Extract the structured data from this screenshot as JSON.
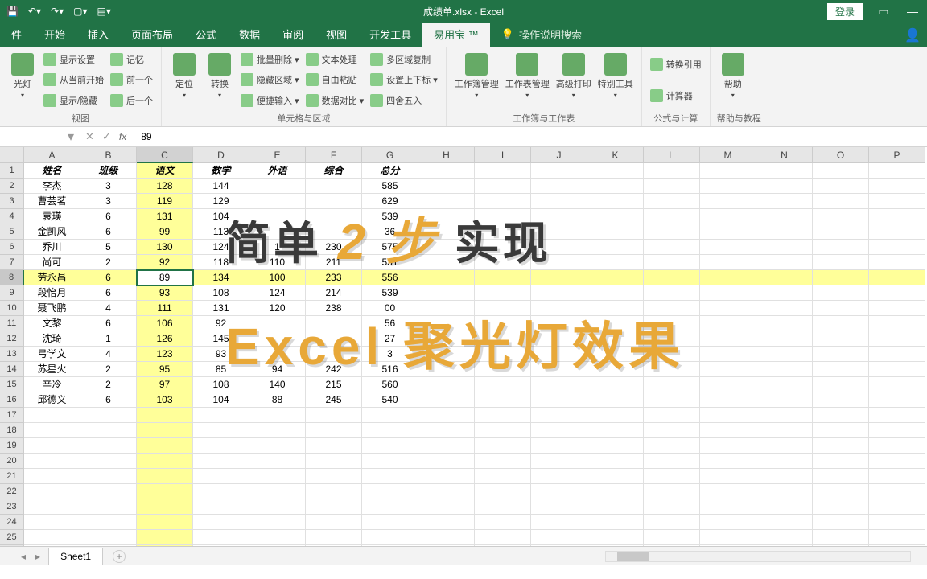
{
  "titlebar": {
    "title": "成绩单.xlsx - Excel",
    "login": "登录",
    "qat_icons": [
      "save-icon",
      "undo-icon",
      "redo-icon",
      "new-icon",
      "share-icon"
    ]
  },
  "tabs": {
    "items": [
      "件",
      "开始",
      "插入",
      "页面布局",
      "公式",
      "数据",
      "审阅",
      "视图",
      "开发工具",
      "易用宝 ™"
    ],
    "active_index": 9,
    "tell_me": "操作说明搜索"
  },
  "ribbon": {
    "groups": [
      {
        "label": "视图",
        "big": [
          {
            "icon": "spotlight",
            "label": "光灯"
          }
        ],
        "small": [
          "显示设置",
          "从当前开始",
          "显示/隐藏",
          "记忆",
          "前一个",
          "后一个"
        ]
      },
      {
        "label": "单元格与区域",
        "big": [
          {
            "icon": "locate",
            "label": "定位"
          },
          {
            "icon": "transform",
            "label": "转换"
          }
        ],
        "small": [
          "批量删除 ▾",
          "隐藏区域 ▾",
          "便捷输入 ▾",
          "文本处理",
          "自由粘贴",
          "数据对比 ▾",
          "多区域复制",
          "设置上下标 ▾",
          "四舍五入"
        ]
      },
      {
        "label": "工作簿与工作表",
        "big": [
          {
            "icon": "wb",
            "label": "工作簿管理"
          },
          {
            "icon": "ws",
            "label": "工作表管理"
          },
          {
            "icon": "print",
            "label": "高级打印"
          },
          {
            "icon": "tools",
            "label": "特别工具"
          }
        ],
        "small": []
      },
      {
        "label": "公式与计算",
        "big": [],
        "small": [
          "转换引用",
          "计算器"
        ]
      },
      {
        "label": "帮助与教程",
        "big": [
          {
            "icon": "help",
            "label": "帮助"
          }
        ],
        "small": []
      }
    ]
  },
  "namebox": {
    "ref": "",
    "formula": "89"
  },
  "columns": [
    "A",
    "B",
    "C",
    "D",
    "E",
    "F",
    "G",
    "H",
    "I",
    "J",
    "K",
    "L",
    "M",
    "N",
    "O",
    "P"
  ],
  "selected_col_index": 2,
  "selected_row_index": 7,
  "headers": [
    "姓名",
    "班级",
    "语文",
    "数学",
    "外语",
    "综合",
    "总分"
  ],
  "rows": [
    [
      "李杰",
      "3",
      "128",
      "144",
      "",
      "",
      "585"
    ],
    [
      "曹芸茗",
      "3",
      "119",
      "129",
      "",
      "",
      "629"
    ],
    [
      "袁瑛",
      "6",
      "131",
      "104",
      "",
      "",
      "539"
    ],
    [
      "金凯风",
      "6",
      "99",
      "113",
      "",
      "",
      "36"
    ],
    [
      "乔川",
      "5",
      "130",
      "124",
      "1",
      "230",
      "575"
    ],
    [
      "尚可",
      "2",
      "92",
      "118",
      "110",
      "211",
      "531"
    ],
    [
      "劳永昌",
      "6",
      "89",
      "134",
      "100",
      "233",
      "556"
    ],
    [
      "段怡月",
      "6",
      "93",
      "108",
      "124",
      "214",
      "539"
    ],
    [
      "聂飞鹏",
      "4",
      "111",
      "131",
      "120",
      "238",
      "00"
    ],
    [
      "文黎",
      "6",
      "106",
      "92",
      "",
      "",
      "56"
    ],
    [
      "沈琦",
      "1",
      "126",
      "145",
      "",
      "",
      "27"
    ],
    [
      "弓学文",
      "4",
      "123",
      "93",
      "",
      "",
      "3"
    ],
    [
      "苏星火",
      "2",
      "95",
      "85",
      "94",
      "242",
      "516"
    ],
    [
      "辛冷",
      "2",
      "97",
      "108",
      "140",
      "215",
      "560"
    ],
    [
      "邱德义",
      "6",
      "103",
      "104",
      "88",
      "245",
      "540"
    ]
  ],
  "sheet": {
    "active": "Sheet1"
  },
  "overlay": {
    "line1_a": "简单 ",
    "line1_em": "2 步",
    "line1_b": " 实现",
    "line2": "Excel 聚光灯效果"
  }
}
